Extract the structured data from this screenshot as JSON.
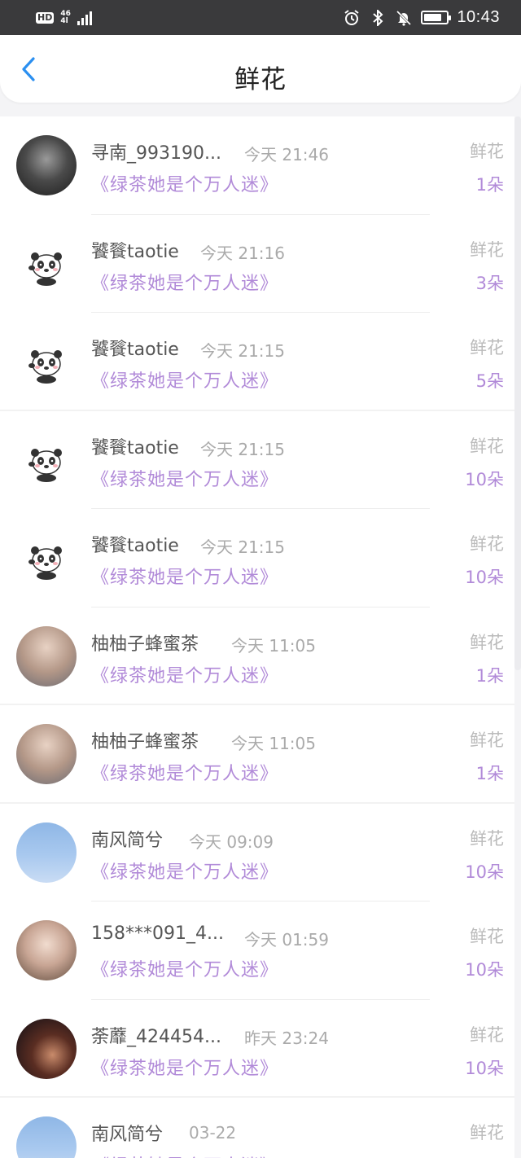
{
  "status_bar": {
    "hd": "HD",
    "network_top": "46",
    "network_bottom": "4l",
    "time": "10:43"
  },
  "header": {
    "title": "鲜花",
    "back_icon": "chevron-left-icon",
    "accent": "#2b8ff0"
  },
  "colors": {
    "book_title": "#b18ad8",
    "count": "#b18ad8",
    "type": "#bbbbbb"
  },
  "rows": [
    {
      "name": "寻南_993190...",
      "time": "今天 21:46",
      "book": "《绿茶她是个万人迷》",
      "type": "鲜花",
      "count": "1朵",
      "avatar": "photo-dark"
    },
    {
      "name": "饕餮taotie",
      "time": "今天 21:16",
      "book": "《绿茶她是个万人迷》",
      "type": "鲜花",
      "count": "3朵",
      "avatar": "panda"
    },
    {
      "name": "饕餮taotie",
      "time": "今天 21:15",
      "book": "《绿茶她是个万人迷》",
      "type": "鲜花",
      "count": "5朵",
      "avatar": "panda"
    },
    {
      "name": "饕餮taotie",
      "time": "今天 21:15",
      "book": "《绿茶她是个万人迷》",
      "type": "鲜花",
      "count": "10朵",
      "avatar": "panda"
    },
    {
      "name": "饕餮taotie",
      "time": "今天 21:15",
      "book": "《绿茶她是个万人迷》",
      "type": "鲜花",
      "count": "10朵",
      "avatar": "panda"
    },
    {
      "name": "柚柚子蜂蜜茶",
      "time": "今天 11:05",
      "book": "《绿茶她是个万人迷》",
      "type": "鲜花",
      "count": "1朵",
      "avatar": "photo-boy"
    },
    {
      "name": "柚柚子蜂蜜茶",
      "time": "今天 11:05",
      "book": "《绿茶她是个万人迷》",
      "type": "鲜花",
      "count": "1朵",
      "avatar": "photo-boy"
    },
    {
      "name": "南风简兮",
      "time": "今天 09:09",
      "book": "《绿茶她是个万人迷》",
      "type": "鲜花",
      "count": "10朵",
      "avatar": "sky"
    },
    {
      "name": "158***091_4...",
      "time": "今天 01:59",
      "book": "《绿茶她是个万人迷》",
      "type": "鲜花",
      "count": "10朵",
      "avatar": "girl"
    },
    {
      "name": "荼蘼_424454...",
      "time": "昨天 23:24",
      "book": "《绿茶她是个万人迷》",
      "type": "鲜花",
      "count": "10朵",
      "avatar": "night"
    },
    {
      "name": "南风简兮",
      "time": "03-22",
      "book": "《绿茶她是个万人迷》",
      "type": "鲜花",
      "count": "",
      "avatar": "sky"
    }
  ]
}
